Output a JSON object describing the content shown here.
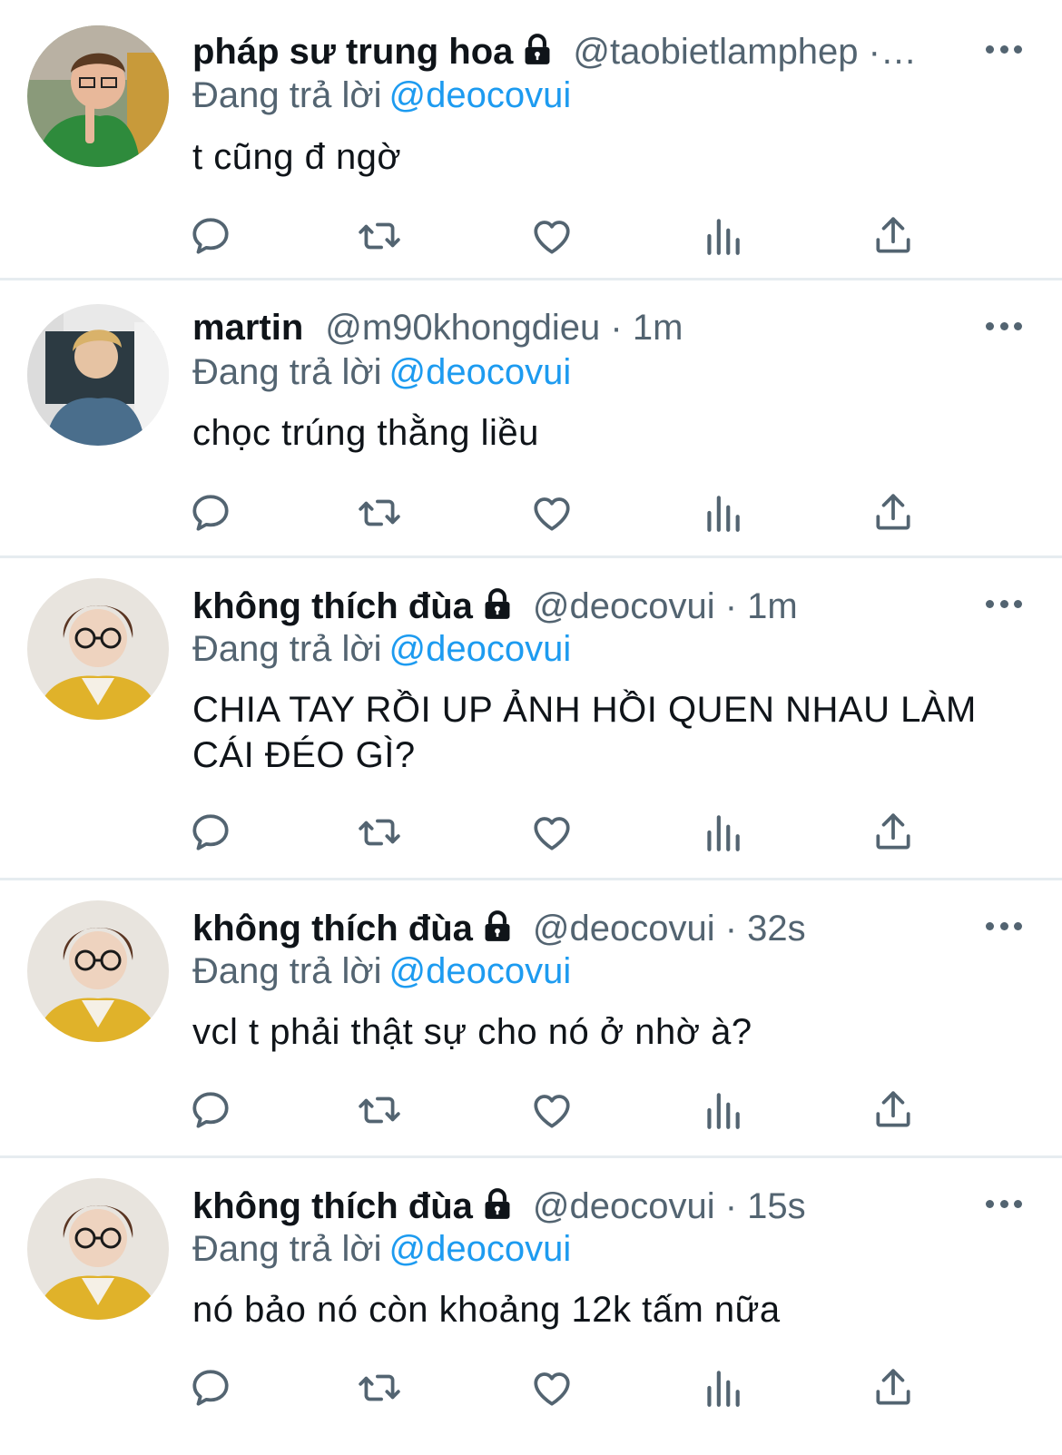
{
  "colors": {
    "text": "#0f1419",
    "muted": "#536471",
    "link": "#1d9bf0",
    "divider": "#e6ecf0"
  },
  "tweets": [
    {
      "name": "pháp sư trung hoa",
      "locked": true,
      "handle": "@taobietlamphep ·…",
      "time": "",
      "reply_prefix": "Đang trả lời",
      "reply_to": "@deocovui",
      "text": "t cũng đ ngờ"
    },
    {
      "name": "martin",
      "locked": false,
      "handle": "@m90khongdieu",
      "time": "· 1m",
      "reply_prefix": "Đang trả lời",
      "reply_to": "@deocovui",
      "text": "chọc trúng thằng liều"
    },
    {
      "name": "không thích đùa",
      "locked": true,
      "handle": "@deocovui",
      "time": "· 1m",
      "reply_prefix": "Đang trả lời",
      "reply_to": "@deocovui",
      "text": "CHIA TAY RỒI UP ẢNH HỒI QUEN NHAU LÀM CÁI ĐÉO GÌ?"
    },
    {
      "name": "không thích đùa",
      "locked": true,
      "handle": "@deocovui",
      "time": "· 32s",
      "reply_prefix": "Đang trả lời",
      "reply_to": "@deocovui",
      "text": "vcl t phải thật sự cho nó ở nhờ à?"
    },
    {
      "name": "không thích đùa",
      "locked": true,
      "handle": "@deocovui",
      "time": "· 15s",
      "reply_prefix": "Đang trả lời",
      "reply_to": "@deocovui",
      "text": "nó bảo nó còn khoảng 12k tấm nữa"
    }
  ],
  "action_icons": [
    "reply-icon",
    "retweet-icon",
    "like-icon",
    "views-icon",
    "share-icon"
  ]
}
